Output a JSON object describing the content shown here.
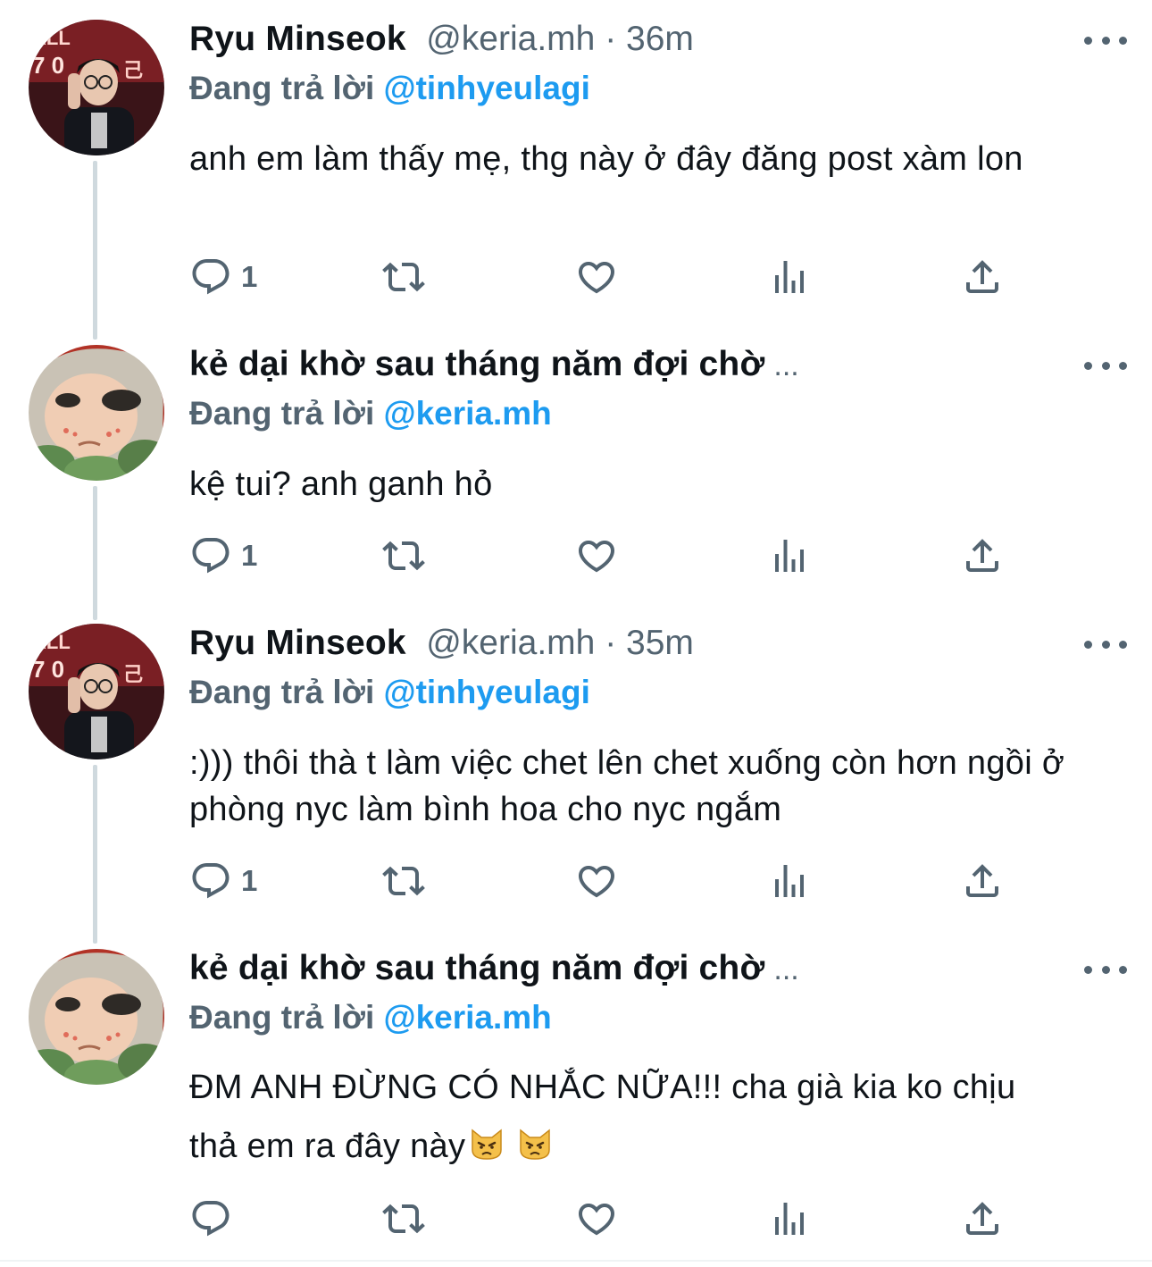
{
  "tweets": [
    {
      "name": "Ryu Minseok",
      "handle": "@keria.mh",
      "time": "36m",
      "reply_label": "Đang trả lời",
      "reply_to": "@tinhyeulagi",
      "text": "anh em làm thấy mẹ, thg này ở đây đăng post xàm lon",
      "reply_count": "1",
      "avatar": "esports-player-avatar"
    },
    {
      "name": "kẻ dại khờ sau tháng năm đợi chờ",
      "name_ellipsis": "...",
      "reply_label": "Đang trả lời",
      "reply_to": "@keria.mh",
      "text": "kệ tui? anh ganh hỏ",
      "reply_count": "1",
      "avatar": "flower-doll-avatar"
    },
    {
      "name": "Ryu Minseok",
      "handle": "@keria.mh",
      "time": "35m",
      "reply_label": "Đang trả lời",
      "reply_to": "@tinhyeulagi",
      "text": ":))) thôi thà t làm việc chet lên chet xuống còn hơn ngồi ở phòng nyc làm bình hoa cho nyc ngắm",
      "reply_count": "1",
      "avatar": "esports-player-avatar"
    },
    {
      "name": "kẻ dại khờ sau tháng năm đợi chờ",
      "name_ellipsis": "...",
      "reply_label": "Đang trả lời",
      "reply_to": "@keria.mh",
      "text": "ĐM ANH ĐỪNG CÓ NHẮC NỮA!!! cha già kia ko chịu thả em ra đây này",
      "emoji": [
        "pouting-cat",
        "pouting-cat"
      ],
      "reply_count": "",
      "avatar": "flower-doll-avatar"
    }
  ],
  "icons": {
    "reply": "reply-icon",
    "retweet": "retweet-icon",
    "like": "like-icon",
    "views": "views-icon",
    "share": "share-icon",
    "more": "more-icon"
  },
  "colors": {
    "mention": "#1d9bf0",
    "secondary": "#536471",
    "thread_line": "#cfd9de"
  }
}
